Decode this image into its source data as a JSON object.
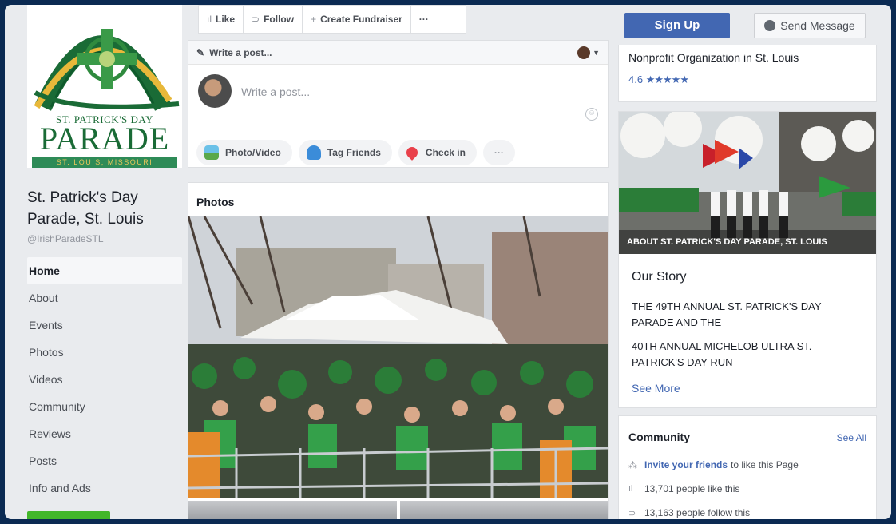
{
  "page": {
    "logo_line1": "ST. PATRICK'S DAY",
    "logo_line2": "PARADE",
    "logo_band": "ST. LOUIS, MISSOURI",
    "name": "St. Patrick's Day Parade, St. Louis",
    "handle": "@IrishParadeSTL"
  },
  "sidebar": {
    "items": [
      {
        "label": "Home",
        "active": true
      },
      {
        "label": "About"
      },
      {
        "label": "Events"
      },
      {
        "label": "Photos"
      },
      {
        "label": "Videos"
      },
      {
        "label": "Community"
      },
      {
        "label": "Reviews"
      },
      {
        "label": "Posts"
      },
      {
        "label": "Info and Ads"
      }
    ]
  },
  "actionbar": {
    "like": "Like",
    "follow": "Follow",
    "fundraiser": "Create Fundraiser",
    "more": "···"
  },
  "composer": {
    "header": "Write a post...",
    "placeholder": "Write a post...",
    "photo_video": "Photo/Video",
    "tag_friends": "Tag Friends",
    "check_in": "Check in",
    "more": "···"
  },
  "photos": {
    "title": "Photos"
  },
  "header_buttons": {
    "signup": "Sign Up",
    "send_message": "Send Message"
  },
  "info": {
    "category": "Nonprofit Organization in St. Louis",
    "rating": "4.6",
    "stars": "★★★★★"
  },
  "about": {
    "caption": "ABOUT ST. PATRICK'S DAY PARADE, ST. LOUIS",
    "heading": "Our Story",
    "p1": "THE 49TH ANNUAL ST. PATRICK'S DAY PARADE AND THE",
    "p2": "40TH ANNUAL MICHELOB ULTRA ST. PATRICK'S DAY RUN",
    "see_more": "See More"
  },
  "community": {
    "title": "Community",
    "see_all": "See All",
    "invite_link": "Invite your friends",
    "invite_rest": "to like this Page",
    "likes": "13,701 people like this",
    "follows": "13,163 people follow this"
  },
  "colors": {
    "brand_blue": "#4267b2",
    "logo_green": "#1a6b36",
    "logo_gold": "#e8b83a"
  }
}
